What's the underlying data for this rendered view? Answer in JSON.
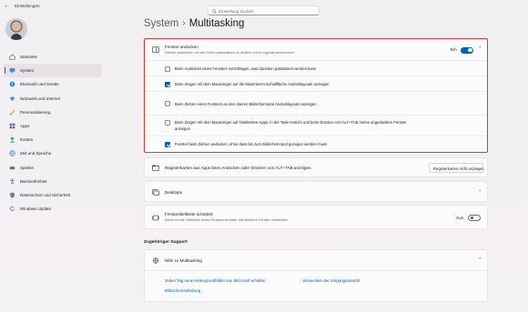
{
  "window": {
    "title": "Einstellungen"
  },
  "search": {
    "placeholder": "Einstellung suchen"
  },
  "sidebar": {
    "items": [
      {
        "label": "Startseite",
        "icon": "home-icon"
      },
      {
        "label": "System",
        "icon": "system-icon",
        "active": true
      },
      {
        "label": "Bluetooth und Geräte",
        "icon": "bluetooth-icon"
      },
      {
        "label": "Netzwerk und Internet",
        "icon": "network-icon"
      },
      {
        "label": "Personalisierung",
        "icon": "brush-icon"
      },
      {
        "label": "Apps",
        "icon": "apps-icon"
      },
      {
        "label": "Konten",
        "icon": "account-icon"
      },
      {
        "label": "Zeit und Sprache",
        "icon": "globe-icon"
      },
      {
        "label": "Spielen",
        "icon": "gamepad-icon"
      },
      {
        "label": "Barrierefreiheit",
        "icon": "accessibility-icon"
      },
      {
        "label": "Datenschutz und Sicherheit",
        "icon": "shield-icon"
      },
      {
        "label": "Windows Update",
        "icon": "update-icon"
      }
    ]
  },
  "breadcrumb": {
    "parent": "System",
    "separator": "›",
    "current": "Multitasking"
  },
  "snap": {
    "title": "Fenster andocken",
    "subtitle": "Fenster andocken, um die Größe automatisch zu ändern und in Layouts anzuordnen",
    "toggle_label": "Ein",
    "toggle_on": true,
    "options": [
      {
        "label": "Beim Andocken eines Fensters vorschlagen, was daneben positioniert werden kann",
        "checked": false
      },
      {
        "label": "Beim Zeigen mit dem Mauszeiger auf die Maximieren-Schaltfläche Andocklayouts anzeigen",
        "checked": true
      },
      {
        "label": "Beim Ziehen eines Fensters an den oberen Bildschirmrand Andocklayouts anzeigen",
        "checked": false
      },
      {
        "label": "Beim Zeigen mit dem Mauszeiger auf Taskleisten-Apps, in der Task-Ansicht und beim Drücken von ALT+TAB meine angedockten Fenster",
        "label2": "anzeigen",
        "checked": false
      },
      {
        "label": "Fenster beim Ziehen andocken, ohne dass bis zum Bildschirmrand gezogen werden muss",
        "checked": true
      }
    ]
  },
  "alttab": {
    "title": "Registerkarten aus Apps beim Andocken oder Drücken von ALT+TAB anzeigen",
    "select_value": "Registerkarten nicht anzeigen"
  },
  "desktops": {
    "title": "Desktops"
  },
  "shake": {
    "title": "Fenstertitelleiste schütteln",
    "subtitle": "Wenn ich die Titelleiste eines Fensters schüttle, alle anderen Fenster verkleinern",
    "toggle_label": "Aus",
    "toggle_on": false
  },
  "support": {
    "section_title": "Zugehöriger Support",
    "help_title": "Hilfe zu Multitasking",
    "links": [
      "Jeden Tag neue Hintergrundbilder von Microsoft erhalten",
      "Verwenden der Vorgangsansicht",
      "Bildschirmaufteilung"
    ]
  },
  "colors": {
    "accent": "#005fb8",
    "highlight_border": "#d83a3a",
    "background": "#f3f0f3"
  }
}
